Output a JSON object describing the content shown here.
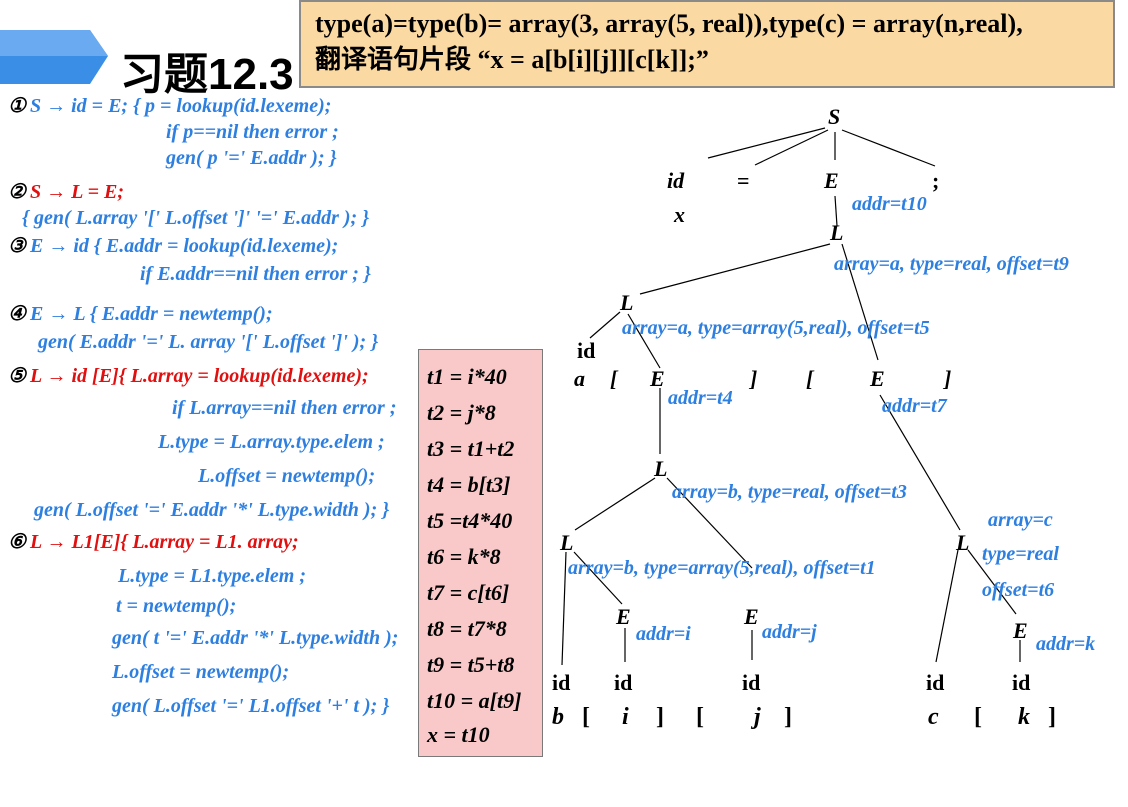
{
  "slide": {
    "title": "习题12.3",
    "header_line1": "type(a)=type(b)= array(3, array(5, real)),type(c) = array(n,real),",
    "header_line2": "翻译语句片段 “x = a[b[i][j]][c[k]];”"
  },
  "rules": [
    {
      "num": "①",
      "lines": [
        "S → id = E; { p = lookup(id.lexeme);",
        "if p==nil then error ;",
        "gen( p '=' E.addr ); }"
      ]
    },
    {
      "num": "②",
      "lines": [
        "S → L = E;",
        "{ gen( L.array '[' L.offset ']' '=' E.addr ); }"
      ]
    },
    {
      "num": "③",
      "lines": [
        "E → id  { E.addr = lookup(id.lexeme);",
        "if E.addr==nil then error ; }"
      ]
    },
    {
      "num": "④",
      "lines": [
        "E → L { E.addr = newtemp();",
        "gen( E.addr '=' L. array '[' L.offset ']' ); }"
      ]
    },
    {
      "num": "⑤",
      "lines": [
        "L → id [E]{ L.array = lookup(id.lexeme);",
        "if L.array==nil then error ;",
        "L.type = L.array.type.elem ;",
        "L.offset = newtemp();",
        "gen( L.offset '=' E.addr '*' L.type.width ); }"
      ]
    },
    {
      "num": "⑥",
      "lines": [
        "L → L1[E]{ L.array = L1. array;",
        "L.type = L1.type.elem ;",
        "t = newtemp();",
        "gen( t '=' E.addr '*' L.type.width );",
        "L.offset = newtemp();",
        "gen( L.offset '=' L1.offset '+' t ); }"
      ]
    }
  ],
  "code": [
    "t1 = i*40",
    "t2 = j*8",
    "t3 = t1+t2",
    "t4 = b[t3]",
    "t5 =t4*40",
    "t6 = k*8",
    "t7 = c[t6]",
    "t8 = t7*8",
    "t9 = t5+t8",
    "t10 = a[t9]",
    "x = t10"
  ],
  "tree": {
    "S": "S",
    "id": "id",
    "eq": "=",
    "E": "E",
    "semi": ";",
    "x": "x",
    "L": "L",
    "lbr": "[",
    "rbr": "]",
    "a": "a",
    "b": "b",
    "c": "c",
    "i": "i",
    "j": "j",
    "k": "k",
    "addr_t10": "addr=t10",
    "L_top": "array=a, type=real, offset=t9",
    "L_a": "array=a, type=array(5,real), offset=t5",
    "addr_t4": "addr=t4",
    "addr_t7": "addr=t7",
    "L_b_real": "array=b, type=real, offset=t3",
    "L_c_array": "array=c",
    "L_c_type": "type=real",
    "L_c_offset": "offset=t6",
    "L_b_arr": "array=b, type=array(5,real), offset=t1",
    "addr_i": "addr=i",
    "addr_j": "addr=j",
    "addr_k": "addr=k"
  },
  "colors": {
    "header_bg": "#fbd9a2",
    "code_bg": "#f9c9c9",
    "blue": "#2d7fe0",
    "red": "#e01010",
    "banner": "#3a8ee6"
  }
}
